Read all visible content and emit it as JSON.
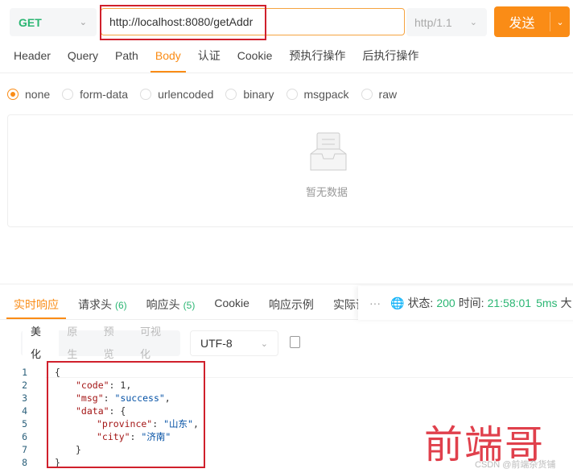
{
  "request": {
    "method": "GET",
    "url": "http://localhost:8080/getAddr",
    "protocol": "http/1.1",
    "send_label": "发送"
  },
  "tabs": [
    "Header",
    "Query",
    "Path",
    "Body",
    "认证",
    "Cookie",
    "预执行操作",
    "后执行操作"
  ],
  "active_tab": "Body",
  "body_types": [
    "none",
    "form-data",
    "urlencoded",
    "binary",
    "msgpack",
    "raw"
  ],
  "selected_body_type": "none",
  "empty_text": "暂无数据",
  "response": {
    "tabs": [
      {
        "label": "实时响应",
        "count": ""
      },
      {
        "label": "请求头",
        "count": "(6)"
      },
      {
        "label": "响应头",
        "count": "(5)"
      },
      {
        "label": "Cookie",
        "count": ""
      },
      {
        "label": "响应示例",
        "count": ""
      },
      {
        "label": "实际请",
        "count": ""
      }
    ],
    "more": "···",
    "status_label": "状态:",
    "status": "200",
    "time_label": "时间:",
    "time": "21:58:01",
    "duration": "5ms",
    "size_label": "大",
    "view_modes": [
      "美化",
      "原生",
      "预览",
      "可视化"
    ],
    "encoding": "UTF-8",
    "code_lines": [
      {
        "n": "1",
        "indent": 0,
        "parts": [
          [
            "p",
            "{"
          ]
        ]
      },
      {
        "n": "2",
        "indent": 1,
        "parts": [
          [
            "k",
            "\"code\""
          ],
          [
            "p",
            ": 1,"
          ]
        ]
      },
      {
        "n": "3",
        "indent": 1,
        "parts": [
          [
            "k",
            "\"msg\""
          ],
          [
            "p",
            ": "
          ],
          [
            "s",
            "\"success\""
          ],
          [
            "p",
            ","
          ]
        ]
      },
      {
        "n": "4",
        "indent": 1,
        "parts": [
          [
            "k",
            "\"data\""
          ],
          [
            "p",
            ": {"
          ]
        ]
      },
      {
        "n": "5",
        "indent": 2,
        "parts": [
          [
            "k",
            "\"province\""
          ],
          [
            "p",
            ": "
          ],
          [
            "s",
            "\"山东\""
          ],
          [
            "p",
            ","
          ]
        ]
      },
      {
        "n": "6",
        "indent": 2,
        "parts": [
          [
            "k",
            "\"city\""
          ],
          [
            "p",
            ": "
          ],
          [
            "s",
            "\"济南\""
          ]
        ]
      },
      {
        "n": "7",
        "indent": 1,
        "parts": [
          [
            "p",
            "}"
          ]
        ]
      },
      {
        "n": "8",
        "indent": 0,
        "parts": [
          [
            "p",
            "}"
          ]
        ]
      }
    ]
  },
  "watermark": "前端哥",
  "csdn_watermark": "CSDN @前端杂货铺",
  "colors": {
    "accent": "#fa8c16",
    "success": "#2bb673",
    "highlight_box": "#d0202c"
  }
}
